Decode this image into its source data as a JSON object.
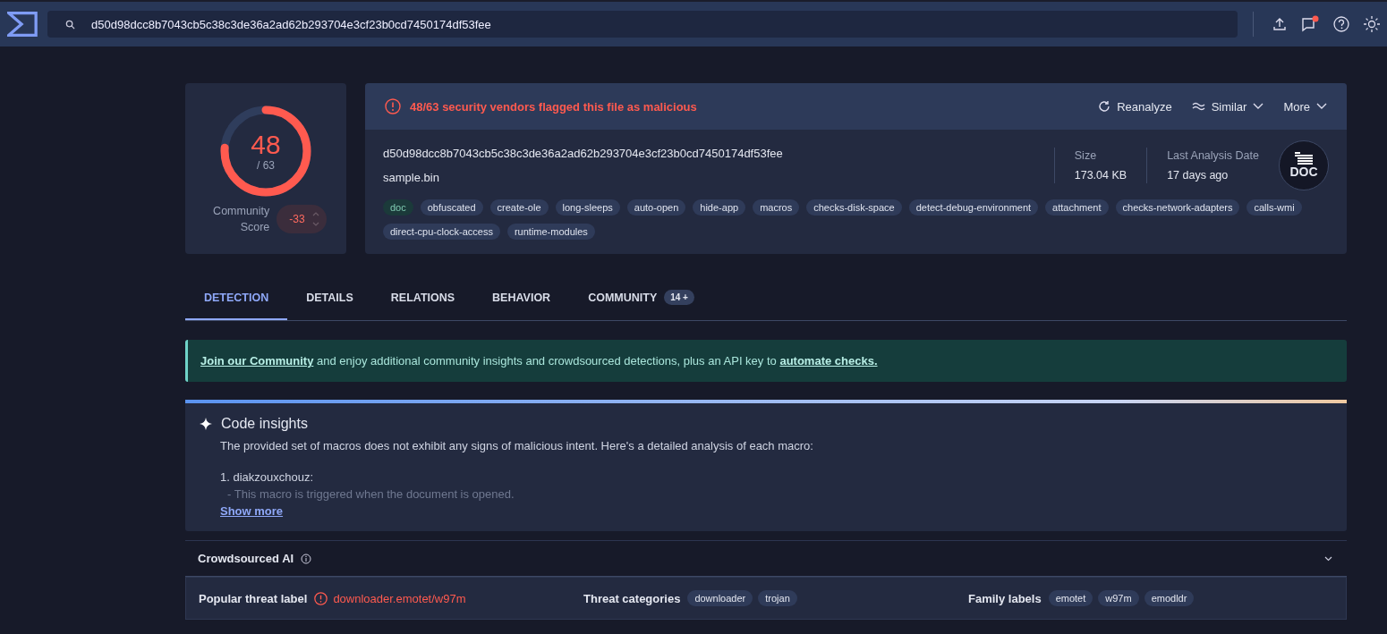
{
  "header": {
    "search_value": "d50d98dcc8b7043cb5c38c3de36a2ad62b293704e3cf23b0cd7450174df53fee",
    "has_notification": true
  },
  "score": {
    "detections": "48",
    "total": "/ 63",
    "level": 0.762,
    "community_label": "Community Score",
    "community_value": "-33"
  },
  "summary": {
    "alert": "48/63 security vendors flagged this file as malicious",
    "actions": [
      {
        "label": "Reanalyze",
        "kind": "reanalyze"
      },
      {
        "label": "Similar",
        "kind": "dropdown"
      },
      {
        "label": "More",
        "kind": "more"
      }
    ],
    "hash": "d50d98dcc8b7043cb5c38c3de36a2ad62b293704e3cf23b0cd7450174df53fee",
    "filename": "sample.bin",
    "stats": [
      {
        "label": "Size",
        "value": "173.04 KB"
      },
      {
        "label": "Last Analysis Date",
        "value": "17 days ago"
      }
    ],
    "file_type": "DOC",
    "tags": [
      {
        "label": "doc",
        "kind": "type"
      },
      {
        "label": "obfuscated",
        "kind": "tag"
      },
      {
        "label": "create-ole",
        "kind": "tag"
      },
      {
        "label": "long-sleeps",
        "kind": "tag"
      },
      {
        "label": "auto-open",
        "kind": "tag"
      },
      {
        "label": "hide-app",
        "kind": "tag"
      },
      {
        "label": "macros",
        "kind": "tag"
      },
      {
        "label": "checks-disk-space",
        "kind": "tag"
      },
      {
        "label": "detect-debug-environment",
        "kind": "tag"
      },
      {
        "label": "attachment",
        "kind": "tag"
      },
      {
        "label": "checks-network-adapters",
        "kind": "tag"
      },
      {
        "label": "calls-wmi",
        "kind": "tag"
      },
      {
        "label": "direct-cpu-clock-access",
        "kind": "tag"
      },
      {
        "label": "runtime-modules",
        "kind": "tag"
      }
    ]
  },
  "tabs": [
    {
      "label": "DETECTION",
      "selected": true
    },
    {
      "label": "DETAILS",
      "selected": false
    },
    {
      "label": "RELATIONS",
      "selected": false
    },
    {
      "label": "BEHAVIOR",
      "selected": false
    },
    {
      "label": "COMMUNITY",
      "selected": false,
      "badge": "14 +"
    }
  ],
  "banner": {
    "link": "Join our Community",
    "text": "and enjoy additional community insights and crowdsourced detections, plus an API key to",
    "link_end": "automate checks."
  },
  "code_insights": {
    "title": "Code insights",
    "intro": "The provided set of macros does not exhibit any signs of malicious intent. Here's a detailed analysis of each macro:",
    "item": "1. diakzouxchouz:",
    "detail": "- This macro is triggered when the document is opened.",
    "show_more": "Show more"
  },
  "crowdsourced_ai": {
    "title": "Crowdsourced AI"
  },
  "threat": {
    "popular_label": "Popular threat label",
    "popular_value": "downloader.emotet/w97m",
    "categories_label": "Threat categories",
    "categories": [
      "downloader",
      "trojan"
    ],
    "family_label": "Family labels",
    "families": [
      "emotet",
      "w97m",
      "emodldr"
    ]
  }
}
